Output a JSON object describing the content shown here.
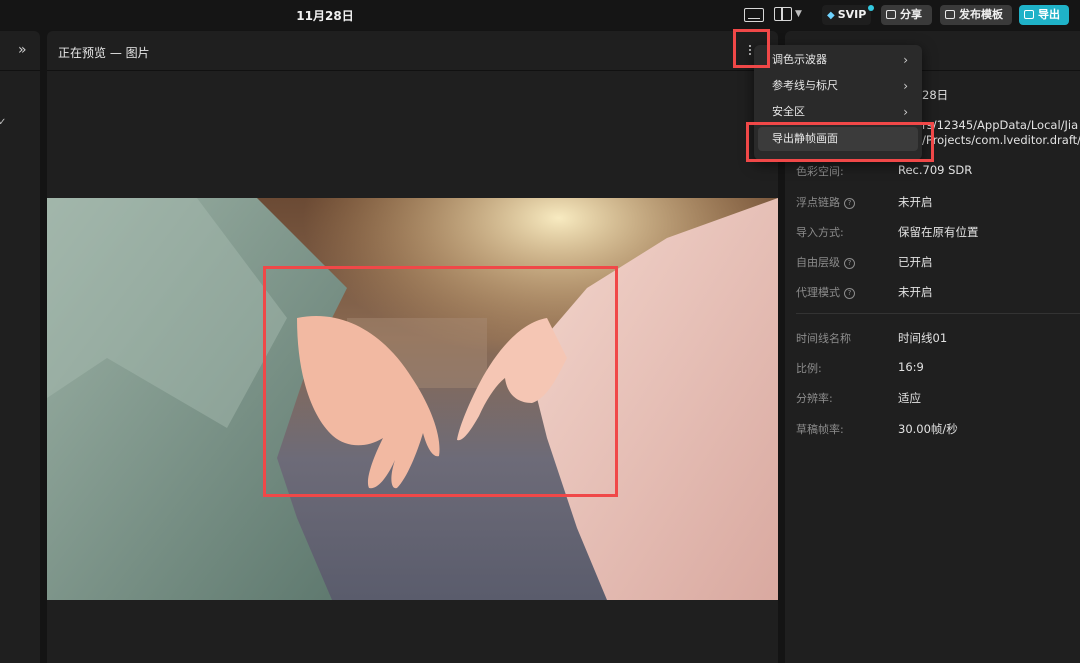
{
  "topbar": {
    "date": "11月28日",
    "svip": "SVIP",
    "share": "分享",
    "publish_template": "发布模板",
    "export": "导出",
    "icons": [
      "keyboard-icon",
      "layout-icon",
      "chevron-down-icon",
      "diamond-icon"
    ]
  },
  "left_panel": {
    "expand_icon": "»"
  },
  "preview": {
    "title": "正在预览 — 图片"
  },
  "menu": {
    "items": [
      {
        "label": "调色示波器",
        "has_submenu": true
      },
      {
        "label": "参考线与标尺",
        "has_submenu": true
      },
      {
        "label": "安全区",
        "has_submenu": true
      },
      {
        "label": "导出静帧画面",
        "has_submenu": false,
        "highlighted": true
      }
    ]
  },
  "details": {
    "date_partial": "28日",
    "path_partial_1": "rs/12345/AppData/Local/Jia",
    "path_partial_2": "/Projects/com.lveditor.draft/1",
    "props": [
      {
        "key": "色彩空间:",
        "value": "Rec.709 SDR",
        "help": false
      },
      {
        "key": "浮点链路",
        "value": "未开启",
        "help": true
      },
      {
        "key": "导入方式:",
        "value": "保留在原有位置",
        "help": false
      },
      {
        "key": "自由层级",
        "value": "已开启",
        "help": true
      },
      {
        "key": "代理模式",
        "value": "未开启",
        "help": true
      }
    ],
    "props2": [
      {
        "key": "时间线名称",
        "value": "时间线01"
      },
      {
        "key": "比例:",
        "value": "16:9"
      },
      {
        "key": "分辨率:",
        "value": "适应"
      },
      {
        "key": "草稿帧率:",
        "value": "30.00帧/秒"
      }
    ]
  },
  "colors": {
    "accent": "#1fb2c8",
    "highlight_box": "#f04848",
    "panel": "#1f1f1f",
    "background": "#141414"
  }
}
